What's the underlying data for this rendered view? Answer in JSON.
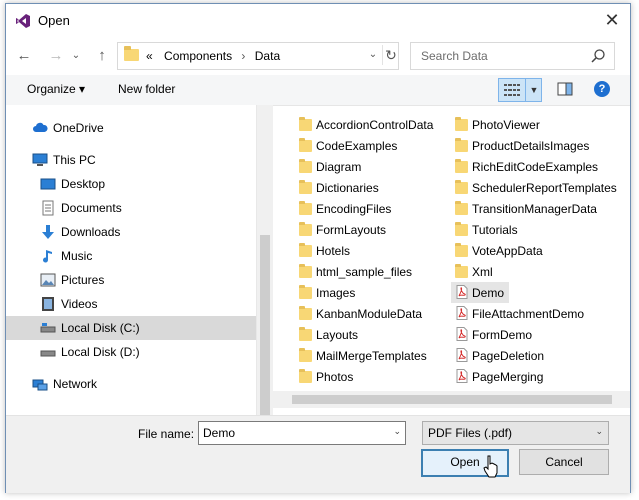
{
  "window": {
    "title": "Open"
  },
  "address": {
    "prefix": "«",
    "crumbs": [
      "Components",
      "Data"
    ]
  },
  "search": {
    "placeholder": "Search Data"
  },
  "toolbar": {
    "organize": "Organize ▾",
    "new_folder": "New folder"
  },
  "nav_items": [
    {
      "label": "OneDrive",
      "icon": "cloud-icon"
    },
    {
      "label": "This PC",
      "icon": "computer-icon"
    },
    {
      "label": "Desktop",
      "icon": "desktop-icon"
    },
    {
      "label": "Documents",
      "icon": "documents-icon"
    },
    {
      "label": "Downloads",
      "icon": "download-icon"
    },
    {
      "label": "Music",
      "icon": "music-icon"
    },
    {
      "label": "Pictures",
      "icon": "pictures-icon"
    },
    {
      "label": "Videos",
      "icon": "videos-icon"
    },
    {
      "label": "Local Disk (C:)",
      "icon": "drive-icon",
      "selected": true
    },
    {
      "label": "Local Disk (D:)",
      "icon": "drive-icon"
    },
    {
      "label": "Network",
      "icon": "network-icon"
    }
  ],
  "files_col1": [
    {
      "name": "AccordionControlData",
      "type": "folder"
    },
    {
      "name": "CodeExamples",
      "type": "folder"
    },
    {
      "name": "Diagram",
      "type": "folder"
    },
    {
      "name": "Dictionaries",
      "type": "folder"
    },
    {
      "name": "EncodingFiles",
      "type": "folder"
    },
    {
      "name": "FormLayouts",
      "type": "folder"
    },
    {
      "name": "Hotels",
      "type": "folder"
    },
    {
      "name": "html_sample_files",
      "type": "folder"
    },
    {
      "name": "Images",
      "type": "folder"
    },
    {
      "name": "KanbanModuleData",
      "type": "folder"
    },
    {
      "name": "Layouts",
      "type": "folder"
    },
    {
      "name": "MailMergeTemplates",
      "type": "folder"
    },
    {
      "name": "Photos",
      "type": "folder"
    }
  ],
  "files_col2": [
    {
      "name": "PhotoViewer",
      "type": "folder"
    },
    {
      "name": "ProductDetailsImages",
      "type": "folder"
    },
    {
      "name": "RichEditCodeExamples",
      "type": "folder"
    },
    {
      "name": "SchedulerReportTemplates",
      "type": "folder"
    },
    {
      "name": "TransitionManagerData",
      "type": "folder"
    },
    {
      "name": "Tutorials",
      "type": "folder"
    },
    {
      "name": "VoteAppData",
      "type": "folder"
    },
    {
      "name": "Xml",
      "type": "folder"
    },
    {
      "name": "Demo",
      "type": "pdf",
      "selected": true
    },
    {
      "name": "FileAttachmentDemo",
      "type": "pdf"
    },
    {
      "name": "FormDemo",
      "type": "pdf"
    },
    {
      "name": "PageDeletion",
      "type": "pdf"
    },
    {
      "name": "PageMerging",
      "type": "pdf"
    }
  ],
  "bottom": {
    "file_name_label": "File name:",
    "file_name_value": "Demo",
    "file_type": "PDF Files (.pdf)",
    "open_label": "Open",
    "cancel_label": "Cancel"
  },
  "colors": {
    "accent": "#1e6fd0",
    "folder": "#f8d775",
    "selection": "#d9d9d9",
    "pdf": "#d42b2b"
  }
}
